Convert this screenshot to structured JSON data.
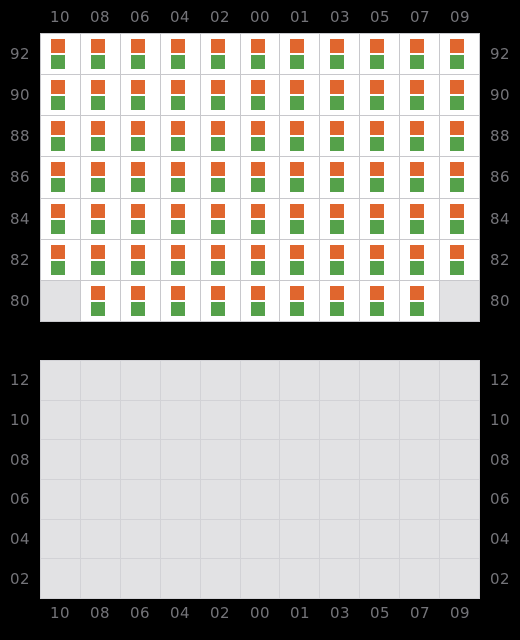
{
  "colors": {
    "background": "#000000",
    "axis_text": "#747479",
    "cell_occupied": "#ffffff",
    "cell_empty": "#e2e2e4",
    "gridline": "#c8c8cc",
    "marker_orange": "#e0662e",
    "marker_green": "#55a14a"
  },
  "columns": [
    "10",
    "08",
    "06",
    "04",
    "02",
    "00",
    "01",
    "03",
    "05",
    "07",
    "09"
  ],
  "top_grid": {
    "rows": [
      "92",
      "90",
      "88",
      "86",
      "84",
      "82",
      "80"
    ],
    "cells": [
      [
        "occupied",
        "occupied",
        "occupied",
        "occupied",
        "occupied",
        "occupied",
        "occupied",
        "occupied",
        "occupied",
        "occupied",
        "occupied"
      ],
      [
        "occupied",
        "occupied",
        "occupied",
        "occupied",
        "occupied",
        "occupied",
        "occupied",
        "occupied",
        "occupied",
        "occupied",
        "occupied"
      ],
      [
        "occupied",
        "occupied",
        "occupied",
        "occupied",
        "occupied",
        "occupied",
        "occupied",
        "occupied",
        "occupied",
        "occupied",
        "occupied"
      ],
      [
        "occupied",
        "occupied",
        "occupied",
        "occupied",
        "occupied",
        "occupied",
        "occupied",
        "occupied",
        "occupied",
        "occupied",
        "occupied"
      ],
      [
        "occupied",
        "occupied",
        "occupied",
        "occupied",
        "occupied",
        "occupied",
        "occupied",
        "occupied",
        "occupied",
        "occupied",
        "occupied"
      ],
      [
        "occupied",
        "occupied",
        "occupied",
        "occupied",
        "occupied",
        "occupied",
        "occupied",
        "occupied",
        "occupied",
        "occupied",
        "occupied"
      ],
      [
        "empty",
        "occupied",
        "occupied",
        "occupied",
        "occupied",
        "occupied",
        "occupied",
        "occupied",
        "occupied",
        "occupied",
        "empty"
      ]
    ],
    "markers": [
      "orange",
      "green"
    ]
  },
  "bottom_grid": {
    "rows": [
      "12",
      "10",
      "08",
      "06",
      "04",
      "02"
    ],
    "cells": [
      [
        "empty",
        "empty",
        "empty",
        "empty",
        "empty",
        "empty",
        "empty",
        "empty",
        "empty",
        "empty",
        "empty"
      ],
      [
        "empty",
        "empty",
        "empty",
        "empty",
        "empty",
        "empty",
        "empty",
        "empty",
        "empty",
        "empty",
        "empty"
      ],
      [
        "empty",
        "empty",
        "empty",
        "empty",
        "empty",
        "empty",
        "empty",
        "empty",
        "empty",
        "empty",
        "empty"
      ],
      [
        "empty",
        "empty",
        "empty",
        "empty",
        "empty",
        "empty",
        "empty",
        "empty",
        "empty",
        "empty",
        "empty"
      ],
      [
        "empty",
        "empty",
        "empty",
        "empty",
        "empty",
        "empty",
        "empty",
        "empty",
        "empty",
        "empty",
        "empty"
      ],
      [
        "empty",
        "empty",
        "empty",
        "empty",
        "empty",
        "empty",
        "empty",
        "empty",
        "empty",
        "empty",
        "empty"
      ]
    ]
  }
}
